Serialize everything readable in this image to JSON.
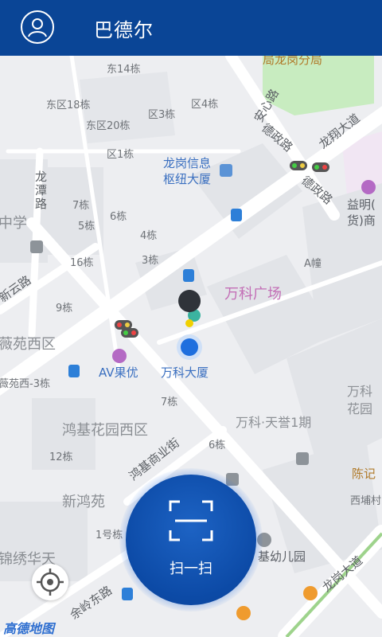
{
  "header": {
    "title": "巴德尔",
    "avatar_icon": "user-circle-icon"
  },
  "map": {
    "labels": {
      "gaoju": "局龙岗分局",
      "east14": "东14栋",
      "east18": "东区18栋",
      "east20": "东区20栋",
      "east3": "区3栋",
      "east4": "区4栋",
      "east1": "区1栋",
      "anxin": "安心路",
      "dezheng1": "德政路",
      "longxiang": "龙翔大道",
      "dezheng2": "德政路",
      "longtan": "龙潭路",
      "zhongxue": "中学",
      "b7": "7栋",
      "b6": "6栋",
      "b5": "5栋",
      "b4": "4栋",
      "b16": "16栋",
      "b3": "3栋",
      "xinyun": "新云路",
      "b9": "9栋",
      "weiyuan": "薇苑西区",
      "weiyuan3": "薇苑西-3栋",
      "hub1": "龙岗信息",
      "hub2": "枢纽大厦",
      "yiming1": "益明(",
      "yiming2": "货)商",
      "aBuilding": "A幢",
      "wanke": "万科广场",
      "av": "AV果优",
      "wankeTower": "万科大厦",
      "b7b": "7栋",
      "wankeTian": "万科·天誉1期",
      "wankeHua1": "万科",
      "wankeHua2": "花园",
      "hongji": "鸿基花园西区",
      "b6b": "6栋",
      "hongjiShang": "鸿基商业街",
      "b12": "12栋",
      "xinhong": "新鸿苑",
      "b1": "1号栋",
      "jinxiu": "锦绣华天",
      "jiyou": "基幼儿园",
      "yuling": "余岭东路",
      "chenji": "陈记",
      "xipu": "西埔村",
      "longgang": "龙岗大道"
    },
    "attribution": "高德地图"
  },
  "controls": {
    "locate_icon": "crosshair-locate-icon",
    "scan_label": "扫一扫",
    "scan_icon": "scan-frame-icon"
  },
  "colors": {
    "header": "#0a4596",
    "scan": "#0c4aa6",
    "park": "#c8ecc0"
  }
}
